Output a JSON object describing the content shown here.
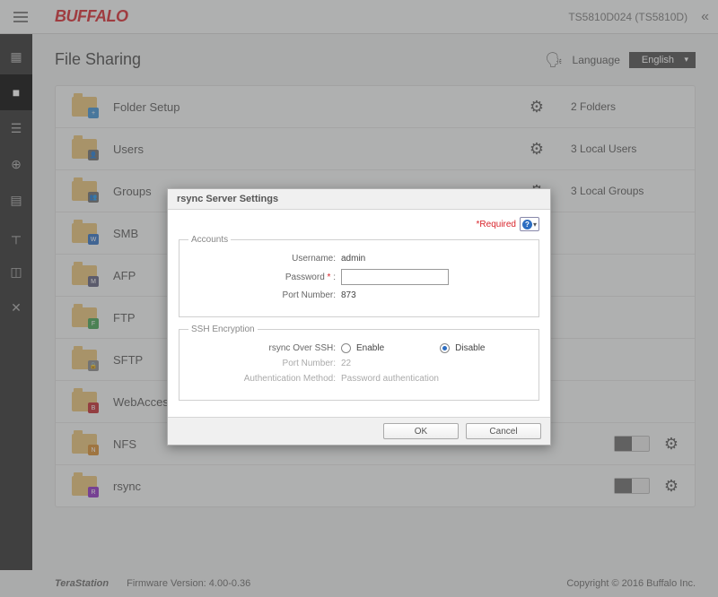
{
  "header": {
    "brand": "BUFFALO",
    "device": "TS5810D024 (TS5810D)"
  },
  "page": {
    "title": "File Sharing",
    "language_label": "Language",
    "language_value": "English"
  },
  "rows": [
    {
      "label": "Folder Setup",
      "status": "2 Folders",
      "badge_color": "#3b8fd1",
      "has_toggle": false
    },
    {
      "label": "Users",
      "status": "3 Local Users",
      "badge_color": "#6b6b6b",
      "has_toggle": false
    },
    {
      "label": "Groups",
      "status": "3 Local Groups",
      "badge_color": "#6b6b6b",
      "has_toggle": false
    },
    {
      "label": "SMB",
      "status": "",
      "badge_color": "#2c6dc1",
      "has_toggle": false
    },
    {
      "label": "AFP",
      "status": "",
      "badge_color": "#5b5b7b",
      "has_toggle": false
    },
    {
      "label": "FTP",
      "status": "",
      "badge_color": "#3fa04f",
      "has_toggle": false
    },
    {
      "label": "SFTP",
      "status": "",
      "badge_color": "#888",
      "has_toggle": false
    },
    {
      "label": "WebAccess",
      "status": "",
      "badge_color": "#c1272d",
      "has_toggle": false
    },
    {
      "label": "NFS",
      "status": "",
      "badge_color": "#d88a2c",
      "has_toggle": true
    },
    {
      "label": "rsync",
      "status": "",
      "badge_color": "#8c2cc1",
      "has_toggle": true
    }
  ],
  "footer": {
    "brand": "TeraStation",
    "firmware": "Firmware Version: 4.00-0.36",
    "copyright": "Copyright © 2016 Buffalo Inc."
  },
  "dialog": {
    "title": "rsync Server Settings",
    "required_marker": "*Required",
    "accounts_legend": "Accounts",
    "ssh_legend": "SSH Encryption",
    "fields": {
      "username_label": "Username:",
      "username_value": "admin",
      "password_label": "Password",
      "password_colon": ":",
      "port_label": "Port Number:",
      "port_value": "873",
      "rsync_ssh_label": "rsync Over SSH:",
      "enable_label": "Enable",
      "disable_label": "Disable",
      "ssh_port_label": "Port Number:",
      "ssh_port_value": "22",
      "auth_method_label": "Authentication Method:",
      "auth_method_value": "Password authentication"
    },
    "buttons": {
      "ok": "OK",
      "cancel": "Cancel"
    }
  }
}
